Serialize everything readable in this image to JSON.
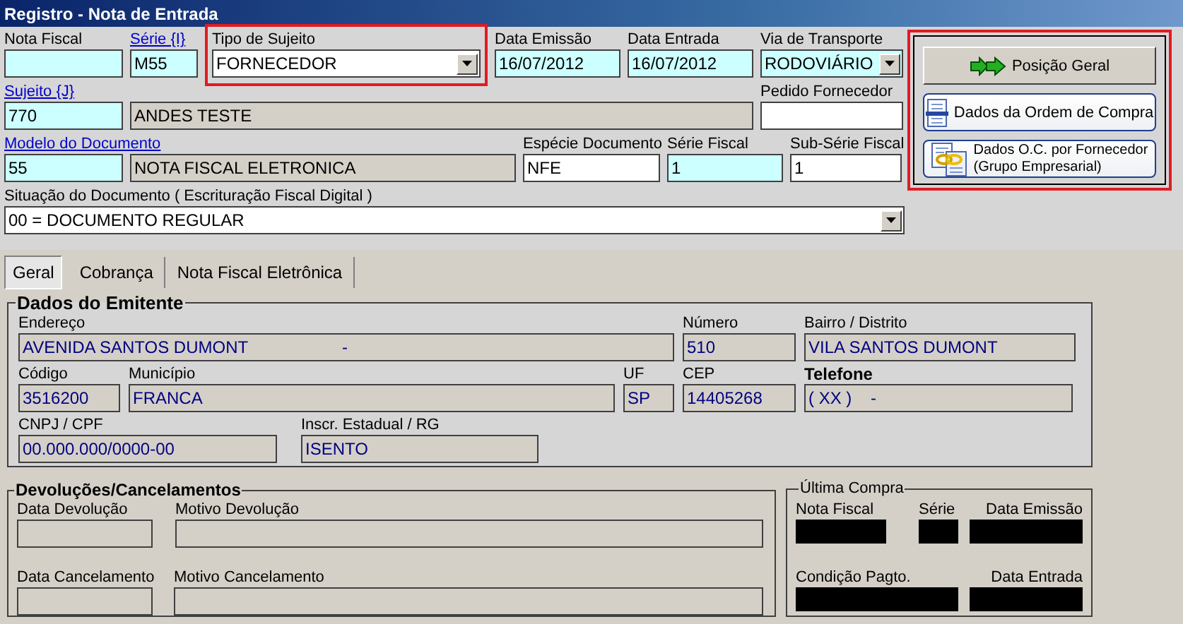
{
  "window": {
    "title": "Registro - Nota de Entrada"
  },
  "header": {
    "rows": [
      {
        "fields": [
          {
            "label": "Nota Fiscal",
            "link": false,
            "kind": "text",
            "required": true,
            "readonly": false,
            "highlighted": false
          },
          {
            "label": "Série {I}",
            "link": true,
            "kind": "text",
            "required": true,
            "readonly": false,
            "value": "M55",
            "highlighted": false
          },
          {
            "label": "Tipo de Sujeito",
            "link": false,
            "kind": "combo",
            "required": false,
            "readonly": false,
            "value": "FORNECEDOR",
            "highlighted": true
          },
          {
            "label": "Data Emissão",
            "link": false,
            "kind": "text",
            "required": true,
            "readonly": false,
            "value": "16/07/2012",
            "highlighted": false
          },
          {
            "label": "Data Entrada",
            "link": false,
            "kind": "text",
            "required": true,
            "readonly": false,
            "value": "16/07/2012",
            "highlighted": false
          },
          {
            "label": "Via de Transporte",
            "link": false,
            "kind": "combo",
            "required": true,
            "readonly": false,
            "value": "RODOVIÁRIO",
            "highlighted": false
          }
        ]
      },
      {
        "fields": [
          {
            "label": "Sujeito {J}",
            "link": true,
            "kind": "text",
            "required": true,
            "readonly": false,
            "value": "770",
            "highlighted": false
          },
          {
            "kind": "text",
            "required": false,
            "readonly": true,
            "value": "ANDES TESTE",
            "highlighted": false
          },
          {
            "label": "Pedido Fornecedor",
            "link": false,
            "kind": "text",
            "required": false,
            "readonly": false,
            "highlighted": false
          }
        ]
      },
      {
        "fields": [
          {
            "label": "Modelo do Documento",
            "link": true,
            "kind": "text",
            "required": true,
            "readonly": false,
            "value": "55",
            "highlighted": false
          },
          {
            "kind": "text",
            "required": false,
            "readonly": true,
            "value": "NOTA FISCAL ELETRONICA",
            "highlighted": false
          },
          {
            "label": "Espécie Documento",
            "link": false,
            "kind": "text",
            "required": false,
            "readonly": false,
            "value": "NFE",
            "highlighted": false
          },
          {
            "label": "Série Fiscal",
            "link": false,
            "kind": "text",
            "required": true,
            "readonly": false,
            "value": "1",
            "highlighted": false
          },
          {
            "label": "Sub-Série Fiscal",
            "link": false,
            "kind": "text",
            "required": false,
            "readonly": false,
            "value": "1",
            "highlighted": false
          }
        ]
      },
      {
        "fields": [
          {
            "label": "Situação do Documento ( Escrituração Fiscal Digital )",
            "link": false,
            "kind": "combo",
            "required": false,
            "readonly": false,
            "value": "00 = DOCUMENTO REGULAR",
            "highlighted": false
          }
        ]
      }
    ]
  },
  "actions": {
    "highlighted": true,
    "buttons": [
      {
        "label": "Posição Geral",
        "kind": "general"
      },
      {
        "label": "Dados da Ordem de Compra",
        "kind": "order"
      },
      {
        "label": "Dados O.C. por Fornecedor\n(Grupo Empresarial)",
        "kind": "group"
      }
    ]
  },
  "tabs": [
    {
      "label": "Geral",
      "selected": true
    },
    {
      "label": "Cobrança",
      "selected": false
    },
    {
      "label": "Nota Fiscal Eletrônica",
      "selected": false
    }
  ],
  "emitente": {
    "title": "Dados do Emitente",
    "rows": [
      {
        "fields": [
          {
            "label": "Endereço",
            "emphasis": false,
            "readonly": true,
            "value": "AVENIDA SANTOS DUMONT                    -"
          },
          {
            "label": "Número",
            "emphasis": false,
            "readonly": true,
            "value": "510"
          },
          {
            "label": "Bairro / Distrito",
            "emphasis": false,
            "readonly": true,
            "value": "VILA SANTOS DUMONT"
          }
        ]
      },
      {
        "fields": [
          {
            "label": "Código",
            "emphasis": false,
            "readonly": true,
            "value": "3516200"
          },
          {
            "label": "Município",
            "emphasis": false,
            "readonly": true,
            "value": "FRANCA"
          },
          {
            "label": "UF",
            "emphasis": false,
            "readonly": true,
            "value": "SP"
          },
          {
            "label": "CEP",
            "emphasis": false,
            "readonly": true,
            "value": "14405268"
          },
          {
            "label": "Telefone",
            "emphasis": true,
            "readonly": true,
            "value": "( XX )    -"
          }
        ]
      },
      {
        "fields": [
          {
            "label": "CNPJ / CPF",
            "emphasis": false,
            "readonly": true,
            "value": "00.000.000/0000-00"
          },
          {
            "label": "Inscr. Estadual / RG",
            "emphasis": false,
            "readonly": true,
            "value": "ISENTO"
          }
        ]
      }
    ]
  },
  "devolucoes": {
    "title": "Devoluções/Cancelamentos",
    "rows": [
      {
        "fields": [
          {
            "label": "Data Devolução",
            "readonly": true
          },
          {
            "label": "Motivo Devolução",
            "readonly": true
          }
        ]
      },
      {
        "fields": [
          {
            "label": "Data Cancelamento",
            "readonly": true
          },
          {
            "label": "Motivo Cancelamento",
            "readonly": true
          }
        ]
      }
    ]
  },
  "ultima_compra": {
    "title": "Última Compra",
    "rows": [
      {
        "fields": [
          {
            "label": "Nota Fiscal",
            "masked": true
          },
          {
            "label": "Série",
            "masked": true
          },
          {
            "label": "Data Emissão",
            "masked": true
          }
        ]
      },
      {
        "fields": [
          {
            "label": "Condição  Pagto.",
            "masked": true
          },
          {
            "label": "Data Entrada",
            "masked": true
          }
        ]
      }
    ]
  }
}
